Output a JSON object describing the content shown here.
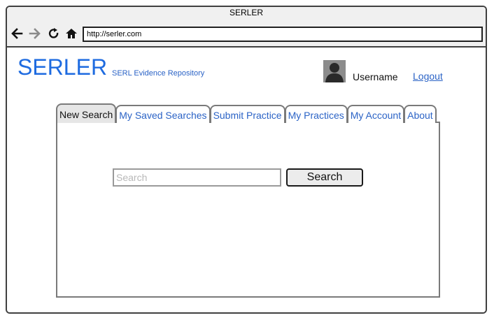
{
  "window": {
    "title": "SERLER"
  },
  "toolbar": {
    "url": "http://serler.com",
    "back_icon": "arrow-left-icon",
    "forward_icon": "arrow-right-icon",
    "reload_icon": "reload-icon",
    "home_icon": "home-icon"
  },
  "header": {
    "brand": "SERLER",
    "tagline": "SERL Evidence Repository",
    "username": "Username",
    "logout": "Logout",
    "avatar_icon": "user-avatar-icon"
  },
  "tabs": [
    {
      "label": "New Search",
      "active": true
    },
    {
      "label": "My Saved Searches",
      "active": false
    },
    {
      "label": "Submit Practice",
      "active": false
    },
    {
      "label": "My Practices",
      "active": false
    },
    {
      "label": "My Account",
      "active": false
    },
    {
      "label": "About",
      "active": false
    }
  ],
  "search": {
    "placeholder": "Search",
    "value": "",
    "button_label": "Search"
  },
  "colors": {
    "brand": "#1e6be0",
    "link": "#2b63c6",
    "active_tab": "#e6e6e6",
    "border": "#7a7a7a"
  }
}
